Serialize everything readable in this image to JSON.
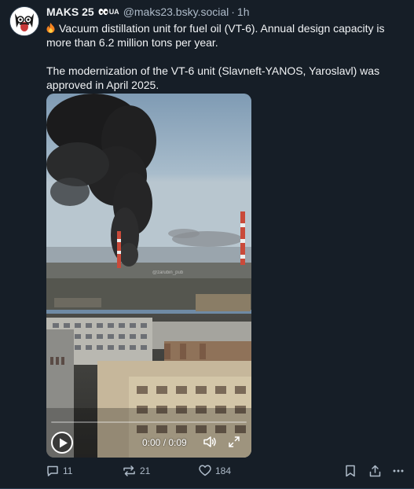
{
  "post": {
    "author": {
      "display_name": "MAKS 25",
      "badge_text": "UA",
      "handle": "@maks23.bsky.social",
      "separator": "·",
      "time_ago": "1h"
    },
    "text": {
      "paragraph1": "Vacuum distillation unit for fuel oil (VT-6). Annual design capacity is more than 6.2 million tons per year.",
      "paragraph2": "The modernization of the VT-6 unit (Slavneft-YANOS, Yaroslavl) was approved in April 2025."
    },
    "video": {
      "current_time": "0:00",
      "duration": "0:09",
      "time_separator": " / ",
      "progress": 0,
      "watermark": "@zarubin_pub"
    },
    "actions": {
      "replies": "11",
      "reposts": "21",
      "likes": "184"
    }
  },
  "theme": {
    "background": "#161e27",
    "text_primary": "#f1f3f5",
    "text_secondary": "#aebbc9",
    "fire_emoji_color": "#f58220"
  },
  "icons": {
    "avatar": "avatar-cartoon-dog",
    "fire": "fire-icon",
    "badge_eyes": "eyes-icon",
    "play": "play-icon",
    "volume": "volume-icon",
    "fullscreen": "fullscreen-icon",
    "reply": "reply-bubble-icon",
    "repost": "repost-icon",
    "like": "heart-icon",
    "bookmark": "bookmark-icon",
    "share": "share-icon",
    "more": "more-dots-icon"
  }
}
